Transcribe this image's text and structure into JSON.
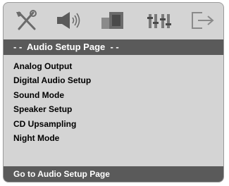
{
  "icons": [
    "general-setup-icon",
    "audio-setup-icon",
    "video-setup-icon",
    "preference-icon",
    "exit-icon"
  ],
  "header": {
    "title": "- -  Audio Setup Page  - -"
  },
  "menu": {
    "items": [
      {
        "label": "Analog Output"
      },
      {
        "label": "Digital Audio Setup"
      },
      {
        "label": "Sound Mode"
      },
      {
        "label": "Speaker Setup"
      },
      {
        "label": "CD Upsampling"
      },
      {
        "label": "Night Mode"
      }
    ]
  },
  "footer": {
    "hint": "Go to Audio Setup Page"
  },
  "colors": {
    "panel": "#d4d4d4",
    "bar": "#5a5a5a",
    "bar_text": "#ffffff"
  }
}
